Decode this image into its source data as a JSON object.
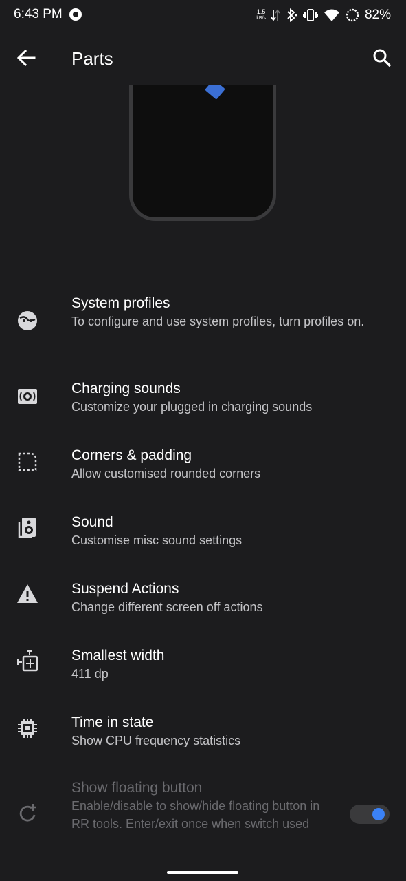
{
  "status_bar": {
    "time": "6:43 PM",
    "net_speed_value": "1.5",
    "net_speed_unit": "kB/s",
    "battery": "82%"
  },
  "app_bar": {
    "title": "Parts"
  },
  "items": [
    {
      "title": "System profiles",
      "summary": "To configure and use system profiles, turn profiles on.",
      "icon": "profile-face-icon"
    },
    {
      "title": "Charging sounds",
      "summary": "Customize your plugged in charging sounds",
      "icon": "charging-sound-icon"
    },
    {
      "title": "Corners & padding",
      "summary": "Allow customised rounded corners",
      "icon": "corners-icon"
    },
    {
      "title": "Sound",
      "summary": "Customise misc sound settings",
      "icon": "speaker-icon"
    },
    {
      "title": "Suspend Actions",
      "summary": "Change different screen off actions",
      "icon": "warning-icon"
    },
    {
      "title": "Smallest width",
      "summary": "411 dp",
      "icon": "smallest-width-icon"
    },
    {
      "title": "Time in state",
      "summary": "Show CPU frequency statistics",
      "icon": "cpu-icon"
    },
    {
      "title": "Show floating button",
      "summary": "Enable/disable to show/hide floating button in RR tools. Enter/exit once when switch used",
      "icon": "refresh-add-icon",
      "enabled": false,
      "toggle_on": true
    }
  ],
  "colors": {
    "background": "#1c1c1e",
    "accent": "#3b82f6",
    "preview_accent": "#3b6fd4"
  }
}
